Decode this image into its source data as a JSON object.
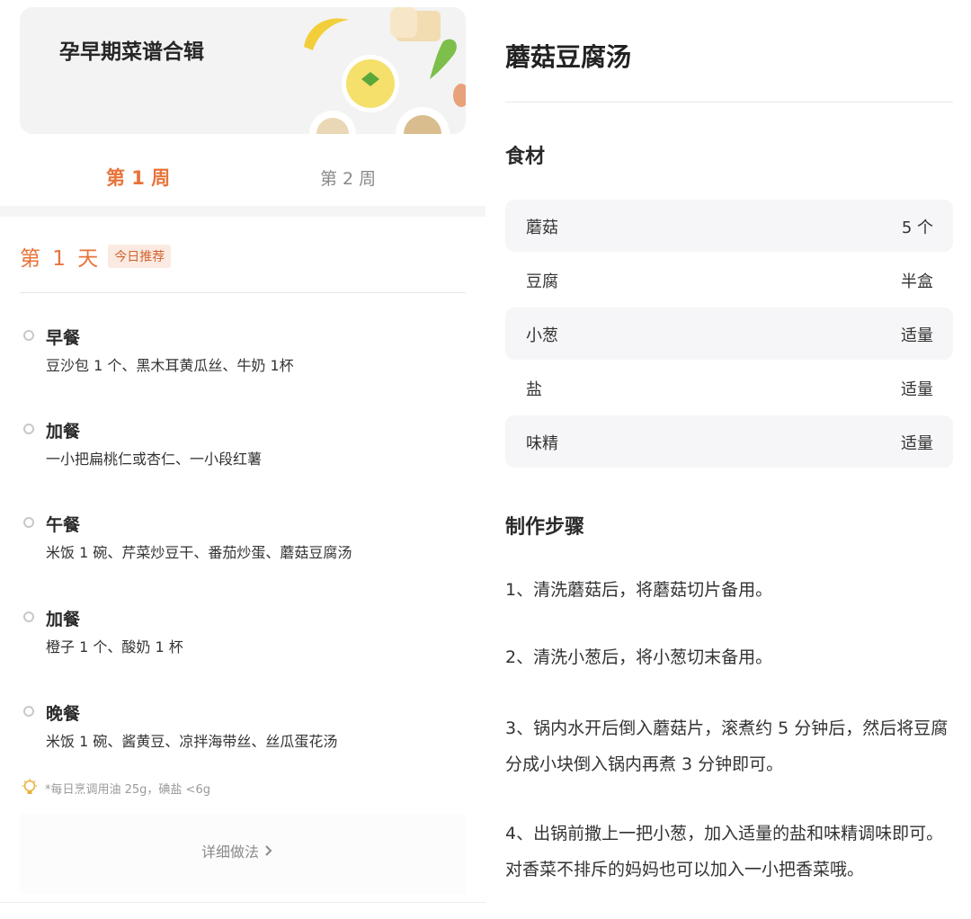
{
  "left": {
    "banner_title": "孕早期菜谱合辑",
    "tabs": [
      {
        "label": "第 1 周",
        "active": true
      },
      {
        "label": "第 2 周",
        "active": false
      }
    ],
    "day_label": "第 1 天",
    "day_badge": "今日推荐",
    "meals": [
      {
        "name": "早餐",
        "desc": "豆沙包 1 个、黑木耳黄瓜丝、牛奶 1杯"
      },
      {
        "name": "加餐",
        "desc": "一小把扁桃仁或杏仁、一小段红薯"
      },
      {
        "name": "午餐",
        "desc": "米饭 1 碗、芹菜炒豆干、番茄炒蛋、蘑菇豆腐汤"
      },
      {
        "name": "加餐",
        "desc": "橙子 1 个、酸奶 1 杯"
      },
      {
        "name": "晚餐",
        "desc": "米饭 1 碗、酱黄豆、凉拌海带丝、丝瓜蛋花汤"
      }
    ],
    "note": "*每日烹调用油 25g，碘盐 <6g",
    "detail_link": "详细做法"
  },
  "right": {
    "title": "蘑菇豆腐汤",
    "ingredients_title": "食材",
    "ingredients": [
      {
        "name": "蘑菇",
        "qty": "5 个"
      },
      {
        "name": "豆腐",
        "qty": "半盒"
      },
      {
        "name": "小葱",
        "qty": "适量"
      },
      {
        "name": "盐",
        "qty": "适量"
      },
      {
        "name": "味精",
        "qty": "适量"
      }
    ],
    "steps_title": "制作步骤",
    "steps": [
      "1、清洗蘑菇后，将蘑菇切片备用。",
      "2、清洗小葱后，将小葱切末备用。",
      "3、锅内水开后倒入蘑菇片，滚煮约 5 分钟后，然后将豆腐分成小块倒入锅内再煮 3 分钟即可。",
      "4、出锅前撒上一把小葱，加入适量的盐和味精调味即可。对香菜不排斥的妈妈也可以加入一小把香菜哦。"
    ]
  },
  "colors": {
    "accent": "#e8733a",
    "badge_bg": "#fbeae2",
    "row_shade": "#f6f6f8",
    "muted_text": "#8a8a8a"
  },
  "icons": {
    "note": "lightbulb-icon",
    "detail": "chevron-right-icon"
  }
}
